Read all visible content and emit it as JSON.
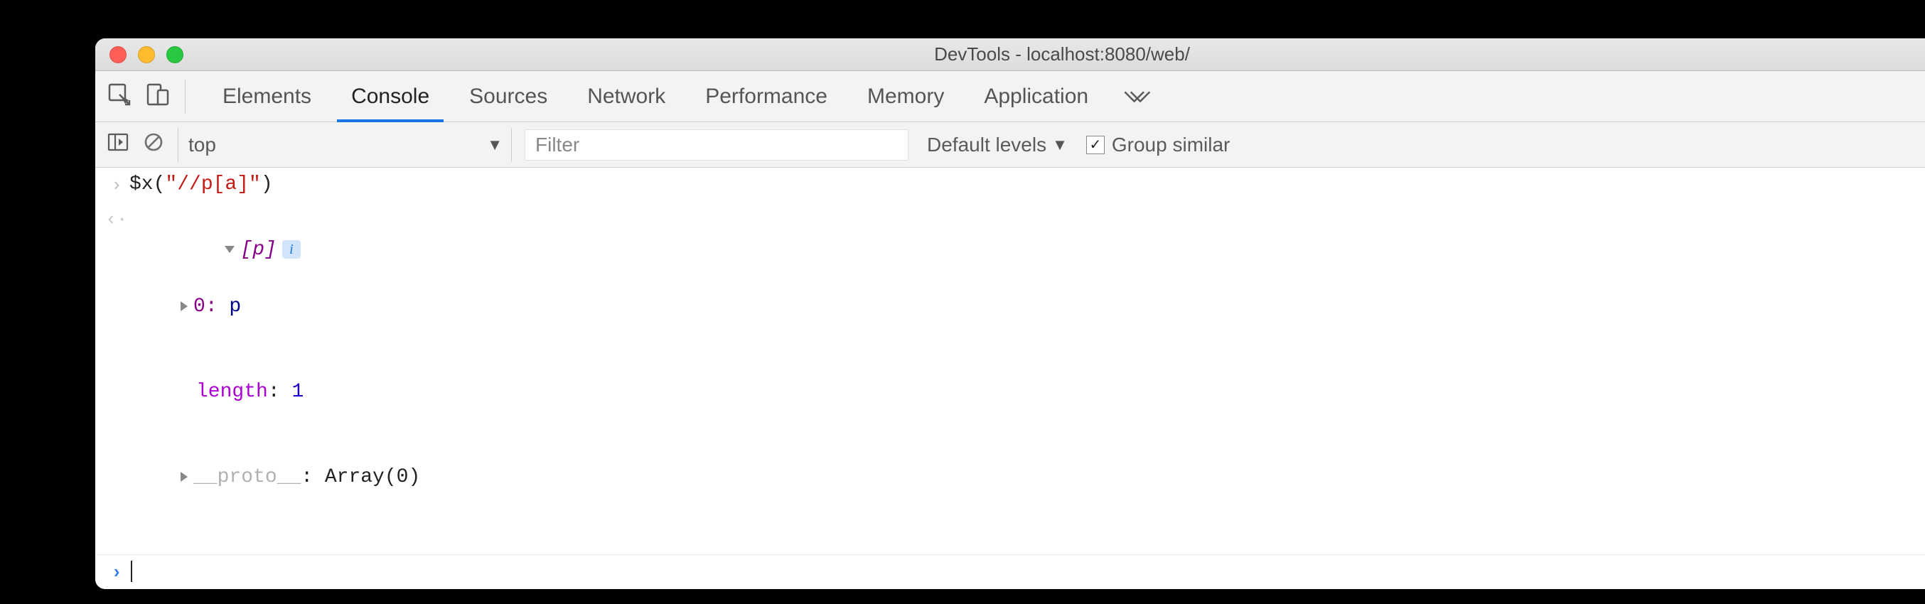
{
  "window": {
    "title": "DevTools - localhost:8080/web/"
  },
  "tabs": {
    "items": [
      "Elements",
      "Console",
      "Sources",
      "Network",
      "Performance",
      "Memory",
      "Application"
    ],
    "active": "Console"
  },
  "filterbar": {
    "context": "top",
    "filter_placeholder": "Filter",
    "levels_label": "Default levels",
    "group_similar_label": "Group similar",
    "group_similar_checked": true
  },
  "console": {
    "input_expr": {
      "fn": "$x",
      "arg": "\"//p[a]\""
    },
    "result": {
      "summary": "[p]",
      "entries": [
        {
          "kind": "index",
          "key": "0",
          "value": "p",
          "expandable": true
        },
        {
          "kind": "prop",
          "key": "length",
          "value": "1",
          "key_color": "purple"
        },
        {
          "kind": "prop",
          "key": "__proto__",
          "value": "Array(0)",
          "key_color": "dim",
          "expandable": true
        }
      ]
    }
  }
}
